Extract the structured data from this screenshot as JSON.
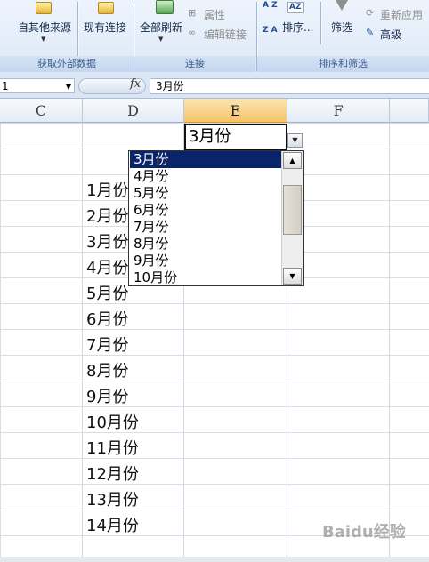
{
  "ribbon": {
    "groups": [
      {
        "title": "获取外部数据",
        "buttons": [
          "自其他来源",
          "现有连接"
        ]
      },
      {
        "title": "连接",
        "buttons": [
          "全部刷新",
          "属性",
          "编辑链接"
        ]
      },
      {
        "title": "排序和筛选",
        "buttons": [
          "排序...",
          "筛选",
          "重新应用",
          "高级"
        ]
      }
    ],
    "sort_az": "A Z",
    "sort_za": "Z A"
  },
  "formula_bar": {
    "name_box": "1",
    "fx_label": "fx",
    "content": "3月份"
  },
  "columns": [
    "C",
    "D",
    "E",
    "F"
  ],
  "selected_column": "E",
  "active_cell": {
    "value": "3月份"
  },
  "column_d_cells": [
    "1月份",
    "2月份",
    "3月份",
    "4月份",
    "5月份",
    "6月份",
    "7月份",
    "8月份",
    "9月份",
    "10月份",
    "11月份",
    "12月份",
    "13月份",
    "14月份"
  ],
  "dropdown": {
    "options": [
      "3月份",
      "4月份",
      "5月份",
      "6月份",
      "7月份",
      "8月份",
      "9月份",
      "10月份"
    ],
    "selected": "3月份"
  },
  "watermark": "Baidu经验",
  "colors": {
    "selection": "#0a246a",
    "header_selected": "#f5c36a",
    "ribbon": "#dce8f7"
  }
}
